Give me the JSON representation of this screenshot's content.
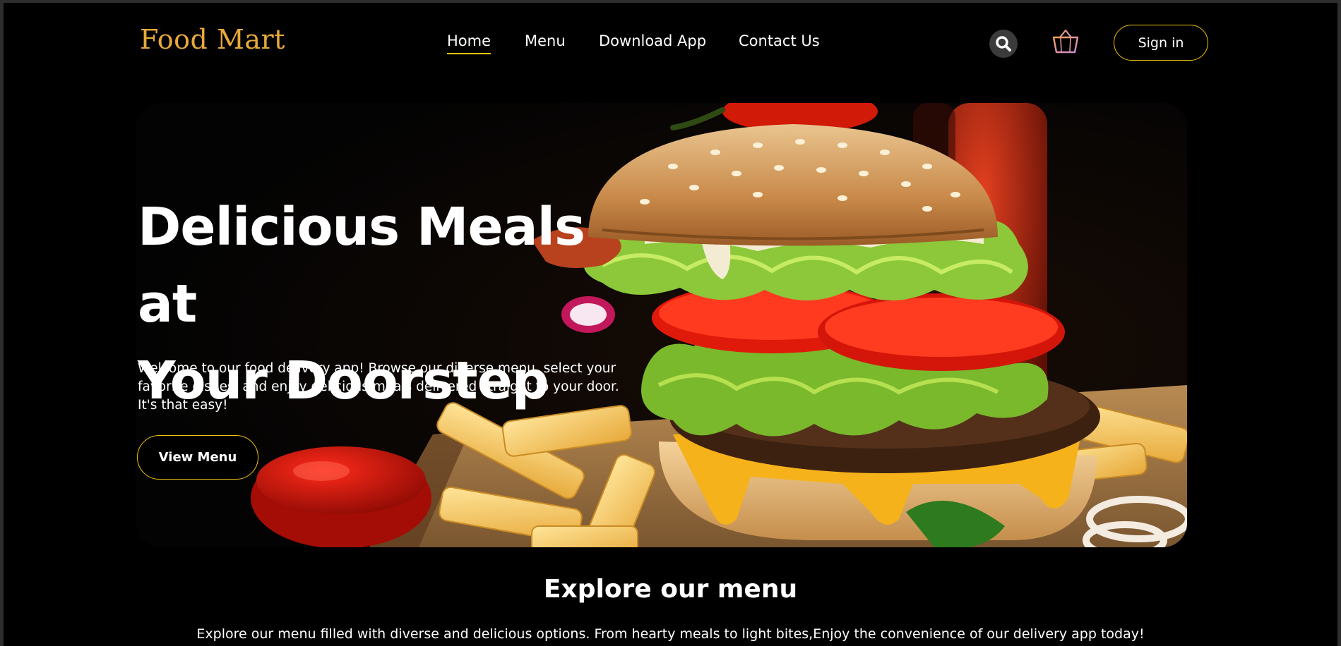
{
  "header": {
    "logo": "Food Mart",
    "nav": [
      {
        "label": "Home",
        "active": true
      },
      {
        "label": "Menu",
        "active": false
      },
      {
        "label": "Download App",
        "active": false
      },
      {
        "label": "Contact Us",
        "active": false
      }
    ],
    "search_icon": "search-icon",
    "cart_icon": "basket-icon",
    "signin_label": "Sign in"
  },
  "hero": {
    "title_line1": "Delicious Meals at",
    "title_line2": "Your Doorstep",
    "description": "Welcome to our food delivery app! Browse our diverse menu, select your favorite dishes, and enjoy delicious meals delivered straight to your door. It's that easy!",
    "cta_label": "View Menu",
    "image": "burger-with-fries-and-ketchup-photo"
  },
  "explore": {
    "title": "Explore our menu",
    "description": "Explore our menu filled with diverse and delicious options. From hearty meals to light bites,Enjoy the convenience of our delivery app today!"
  },
  "colors": {
    "background": "#000000",
    "accent": "#f1c40f",
    "logo": "#e8a93a",
    "text": "#ffffff"
  }
}
